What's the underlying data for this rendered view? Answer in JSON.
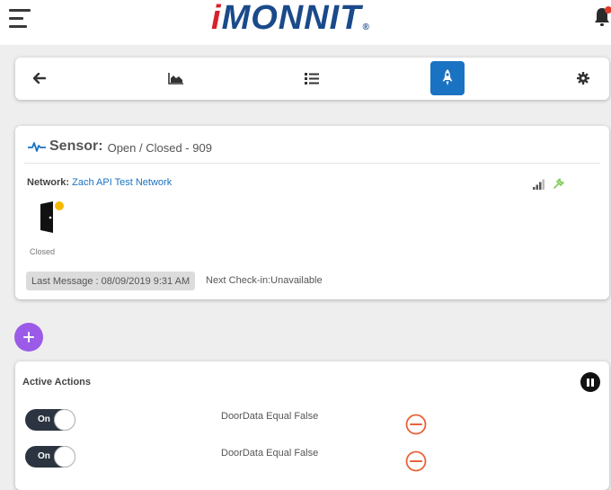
{
  "header": {
    "logo_i": "i",
    "logo_rest": "MONNIT",
    "logo_reg": "®"
  },
  "navbar": {
    "items": [
      {
        "icon": "back-arrow-icon"
      },
      {
        "icon": "area-chart-icon"
      },
      {
        "icon": "list-icon"
      },
      {
        "icon": "rocket-icon",
        "active": true
      },
      {
        "icon": "gear-icon"
      }
    ]
  },
  "sensor": {
    "label": "Sensor:",
    "name": "Open / Closed - 909",
    "network_label": "Network:",
    "network_name": "Zach API Test Network",
    "door_state": "Closed",
    "last_message": "Last Message : 08/09/2019 9:31 AM",
    "next_checkin": "Next Check-in:Unavailable"
  },
  "actions": {
    "title": "Active Actions",
    "items": [
      {
        "toggle": "On",
        "description": "DoorData Equal False"
      },
      {
        "toggle": "On",
        "description": "DoorData Equal False"
      }
    ]
  },
  "colors": {
    "accent": "#1a72c2",
    "logo_red": "#d81f2a",
    "logo_blue": "#1a4a8a",
    "add_purple": "#9b5ae8",
    "remove_orange": "#e8623a",
    "status_yellow": "#f6b800",
    "battery_green": "#7dcc5a"
  }
}
